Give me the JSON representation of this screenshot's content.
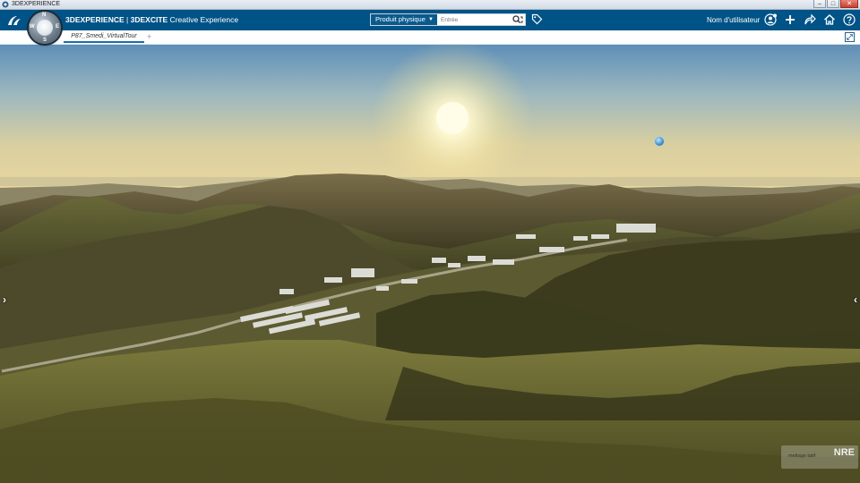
{
  "window": {
    "title": "3DEXPERIENCE",
    "buttons": {
      "minimize": "–",
      "maximize": "□",
      "close": "✕"
    }
  },
  "topbar": {
    "brand_platform": "3DEXPERIENCE",
    "brand_separator": " | ",
    "brand_app_bold": "3DEXCITE",
    "brand_app_rest": " Creative Experience",
    "compass": {
      "n": "N",
      "s": "S",
      "e": "E",
      "w": "W"
    },
    "search": {
      "scope": "Produit physique",
      "placeholder": "Entrée"
    },
    "user_name": "Nom d'utilisateur",
    "icons": [
      "ds-logo-icon",
      "compass-icon",
      "search-icon",
      "tag-icon",
      "user-icon",
      "add-icon",
      "share-icon",
      "home-icon",
      "help-icon"
    ],
    "accent_color": "#005386"
  },
  "tabs": [
    {
      "label": "P87_Smedi_VirtualTour",
      "active": true
    }
  ],
  "tab_add": "+",
  "viewport": {
    "nav_left": "›",
    "nav_right": "‹",
    "watermark_small": "mettage tatif",
    "watermark_big": "NRE"
  }
}
